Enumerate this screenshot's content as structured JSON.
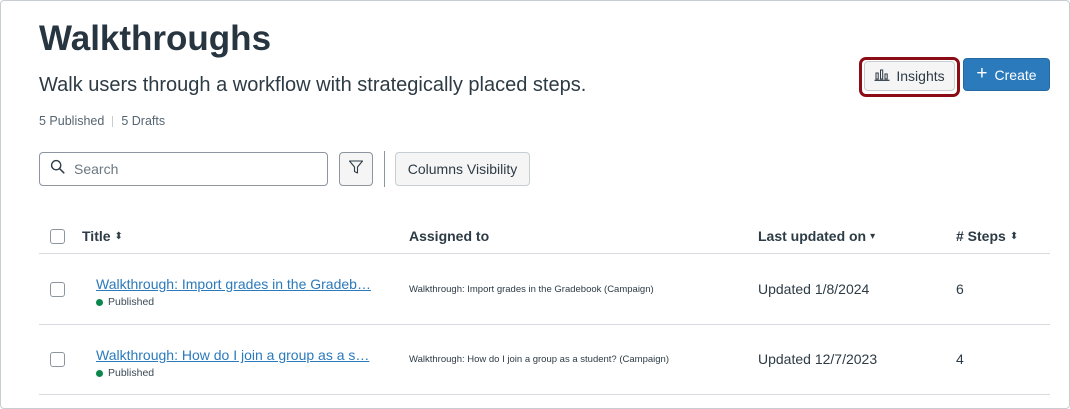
{
  "header": {
    "title": "Walkthroughs",
    "subtitle": "Walk users through a workflow with strategically placed steps.",
    "published_count": "5 Published",
    "drafts_count": "5 Drafts"
  },
  "actions": {
    "insights_label": "Insights",
    "create_label": "Create",
    "accent_color": "#2b7abc",
    "focus_ring_color": "#8b0c14"
  },
  "toolbar": {
    "search_placeholder": "Search",
    "columns_visibility_label": "Columns Visibility"
  },
  "table": {
    "columns": [
      "Title",
      "Assigned to",
      "Last updated on",
      "# Steps"
    ],
    "rows": [
      {
        "title": "Walkthrough: Import grades in the Gradeb…",
        "status": "Published",
        "assigned_to": "Walkthrough: Import grades in the Gradebook (Campaign)",
        "updated": "Updated 1/8/2024",
        "steps": "6"
      },
      {
        "title": "Walkthrough: How do I join a group as a s…",
        "status": "Published",
        "assigned_to": "Walkthrough: How do I join a group as a student? (Campaign)",
        "updated": "Updated 12/7/2023",
        "steps": "4"
      }
    ]
  }
}
